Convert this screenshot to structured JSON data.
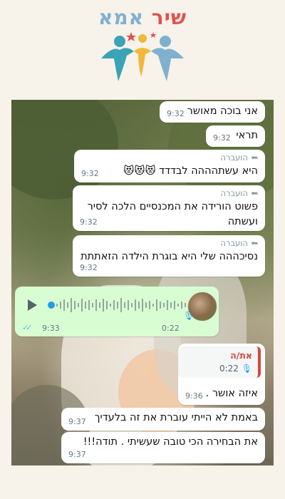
{
  "logo": {
    "word1": "אמא",
    "word2": "שיר",
    "colors": [
      "#3aa3b6",
      "#f0b93a",
      "#7fb1cf",
      "#e0524e"
    ]
  },
  "messages": [
    {
      "text": "אני בוכה מאושר",
      "time": "9:32",
      "forwarded": false
    },
    {
      "text": "תראי",
      "time": "9:32",
      "forwarded": false
    },
    {
      "text": "היא עשתהההה לבדדד 😻😻😻",
      "time": "9:32",
      "forwarded": true
    },
    {
      "text": "פשוט הורידה את המכנסיים הלכה לסיר ועשתה",
      "time": "9:32",
      "forwarded": true
    },
    {
      "text": "נסיכההה שלי היא בוגרת הילדה הזאתתת",
      "time": "9:32",
      "forwarded": true
    }
  ],
  "forward_label": "הועברה",
  "voice_note": {
    "duration": "0:22",
    "time": "9:33",
    "read_ticks": "✓✓"
  },
  "reply": {
    "quoted_name": "את/ה",
    "quoted_duration": "0:22",
    "text": "איזה אושר .",
    "time": "9:36"
  },
  "late_messages": [
    {
      "text": "באמת לא הייתי עוברת את זה בלעדיך",
      "time": "9:37"
    },
    {
      "text": "את הבחירה הכי טובה שעשיתי . תודה!!!",
      "time": "9:37"
    }
  ]
}
